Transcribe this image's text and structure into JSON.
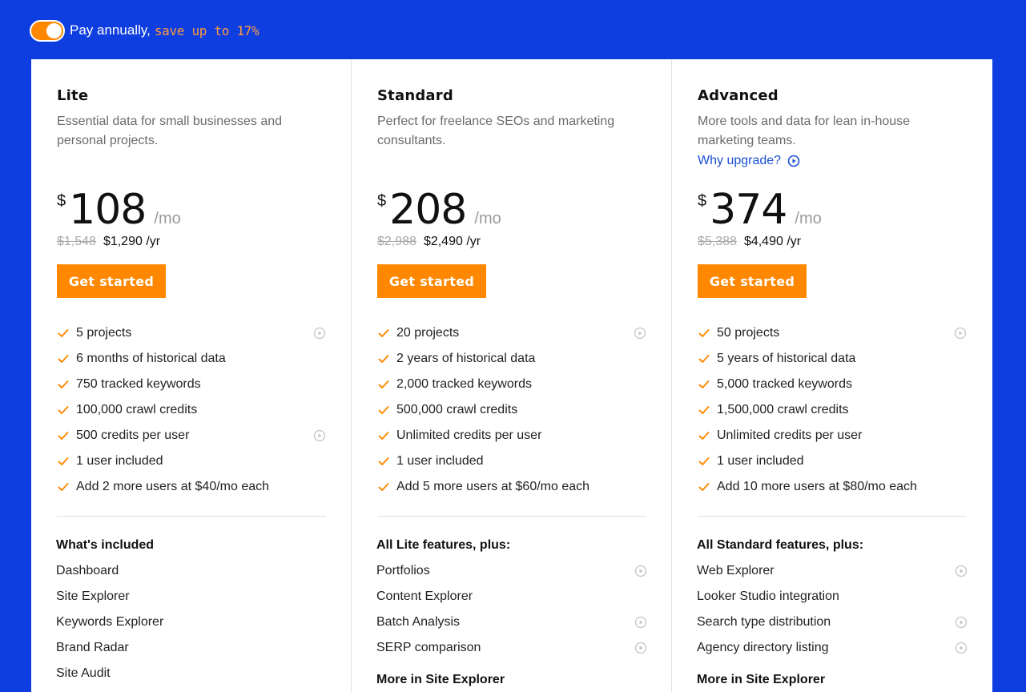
{
  "billing": {
    "toggle_on": true,
    "label": "Pay annually,",
    "savings": "save up to 17%"
  },
  "colors": {
    "background": "#0f3ee0",
    "accent": "#ff8800",
    "link": "#1a4fd6"
  },
  "plans": [
    {
      "name": "Lite",
      "description": "Essential data for small businesses and personal projects.",
      "why_upgrade": "",
      "currency": "$",
      "price": "108",
      "per": "/mo",
      "old_yearly": "$1,548",
      "new_yearly": "$1,290 /yr",
      "cta": "Get started",
      "features": [
        {
          "text": "5 projects",
          "video": true
        },
        {
          "text": "6 months of historical data",
          "video": false
        },
        {
          "text": "750 tracked keywords",
          "video": false
        },
        {
          "text": "100,000 crawl credits",
          "video": false
        },
        {
          "text": "500 credits per user",
          "video": true
        },
        {
          "text": "1 user included",
          "video": false
        },
        {
          "text": "Add 2 more users at $40/mo each",
          "video": false
        }
      ],
      "included_heading": "What's included",
      "included": [
        {
          "text": "Dashboard",
          "video": false
        },
        {
          "text": "Site Explorer",
          "video": false
        },
        {
          "text": "Keywords Explorer",
          "video": false
        },
        {
          "text": "Brand Radar",
          "video": false
        },
        {
          "text": "Site Audit",
          "video": false
        }
      ],
      "more_heading": ""
    },
    {
      "name": "Standard",
      "description": "Perfect for freelance SEOs and marketing consultants.",
      "why_upgrade": "",
      "currency": "$",
      "price": "208",
      "per": "/mo",
      "old_yearly": "$2,988",
      "new_yearly": "$2,490 /yr",
      "cta": "Get started",
      "features": [
        {
          "text": "20 projects",
          "video": true
        },
        {
          "text": "2 years of historical data",
          "video": false
        },
        {
          "text": "2,000 tracked keywords",
          "video": false
        },
        {
          "text": "500,000 crawl credits",
          "video": false
        },
        {
          "text": "Unlimited credits per user",
          "video": false
        },
        {
          "text": "1 user included",
          "video": false
        },
        {
          "text": "Add 5 more users at $60/mo each",
          "video": false
        }
      ],
      "included_heading": "All Lite features, plus:",
      "included": [
        {
          "text": "Portfolios",
          "video": true
        },
        {
          "text": "Content Explorer",
          "video": false
        },
        {
          "text": "Batch Analysis",
          "video": true
        },
        {
          "text": "SERP comparison",
          "video": true
        }
      ],
      "more_heading": "More in Site Explorer"
    },
    {
      "name": "Advanced",
      "description": "More tools and data for lean in-house marketing teams.",
      "why_upgrade": "Why upgrade?",
      "currency": "$",
      "price": "374",
      "per": "/mo",
      "old_yearly": "$5,388",
      "new_yearly": "$4,490 /yr",
      "cta": "Get started",
      "features": [
        {
          "text": "50 projects",
          "video": true
        },
        {
          "text": "5 years of historical data",
          "video": false
        },
        {
          "text": "5,000 tracked keywords",
          "video": false
        },
        {
          "text": "1,500,000 crawl credits",
          "video": false
        },
        {
          "text": "Unlimited credits per user",
          "video": false
        },
        {
          "text": "1 user included",
          "video": false
        },
        {
          "text": "Add 10 more users at $80/mo each",
          "video": false
        }
      ],
      "included_heading": "All Standard features, plus:",
      "included": [
        {
          "text": "Web Explorer",
          "video": true
        },
        {
          "text": "Looker Studio integration",
          "video": false
        },
        {
          "text": "Search type distribution",
          "video": true
        },
        {
          "text": "Agency directory listing",
          "video": true
        }
      ],
      "more_heading": "More in Site Explorer"
    }
  ]
}
